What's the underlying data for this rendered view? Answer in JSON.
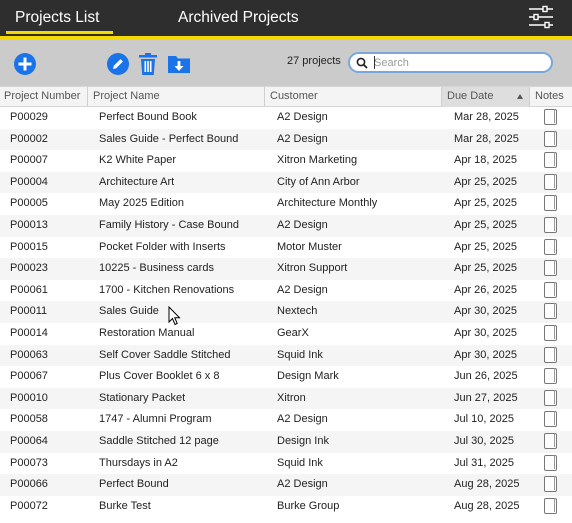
{
  "tabs": {
    "projects_list": "Projects List",
    "archived_projects": "Archived Projects"
  },
  "toolbar": {
    "project_count": "27 projects",
    "search_placeholder": "Search",
    "search_value": ""
  },
  "columns": {
    "project_number": "Project Number",
    "project_name": "Project Name",
    "customer": "Customer",
    "due_date": "Due Date",
    "notes": "Notes"
  },
  "sort": {
    "column": "due_date",
    "direction": "ascending"
  },
  "colors": {
    "accent": "#f5d800",
    "topbar": "#2e2e2e",
    "toolbar": "#cbcbcb",
    "icon_blue": "#1a73e8"
  },
  "icons": {
    "add": "plus-circle-icon",
    "edit": "pencil-icon",
    "delete": "trash-icon",
    "archive": "folder-download-icon",
    "menu": "sliders-icon",
    "search": "search-icon",
    "notes": "note-icon"
  },
  "projects": [
    {
      "number": "P00029",
      "name": "Perfect Bound Book",
      "customer": "A2 Design",
      "due": "Mar 28, 2025"
    },
    {
      "number": "P00002",
      "name": "Sales Guide - Perfect Bound",
      "customer": "A2 Design",
      "due": "Mar 28, 2025"
    },
    {
      "number": "P00007",
      "name": "K2 White Paper",
      "customer": "Xitron Marketing",
      "due": "Apr 18, 2025"
    },
    {
      "number": "P00004",
      "name": "Architecture Art",
      "customer": "City of Ann Arbor",
      "due": "Apr 25, 2025"
    },
    {
      "number": "P00005",
      "name": "May 2025 Edition",
      "customer": "Architecture Monthly",
      "due": "Apr 25, 2025"
    },
    {
      "number": "P00013",
      "name": "Family History - Case Bound",
      "customer": "A2 Design",
      "due": "Apr 25, 2025"
    },
    {
      "number": "P00015",
      "name": "Pocket Folder with Inserts",
      "customer": "Motor Muster",
      "due": "Apr 25, 2025"
    },
    {
      "number": "P00023",
      "name": "10225 - Business cards",
      "customer": "Xitron Support",
      "due": "Apr 25, 2025"
    },
    {
      "number": "P00061",
      "name": "1700 - Kitchen Renovations",
      "customer": "A2 Design",
      "due": "Apr 26, 2025"
    },
    {
      "number": "P00011",
      "name": "Sales Guide",
      "customer": "Nextech",
      "due": "Apr 30, 2025"
    },
    {
      "number": "P00014",
      "name": "Restoration Manual",
      "customer": "GearX",
      "due": "Apr 30, 2025"
    },
    {
      "number": "P00063",
      "name": "Self Cover Saddle Stitched",
      "customer": "Squid Ink",
      "due": "Apr 30, 2025"
    },
    {
      "number": "P00067",
      "name": "Plus Cover Booklet 6 x 8",
      "customer": "Design Mark",
      "due": "Jun 26, 2025"
    },
    {
      "number": "P00010",
      "name": "Stationary Packet",
      "customer": "Xitron",
      "due": "Jun 27, 2025"
    },
    {
      "number": "P00058",
      "name": "1747 - Alumni Program",
      "customer": "A2 Design",
      "due": "Jul 10, 2025"
    },
    {
      "number": "P00064",
      "name": "Saddle Stitched 12 page",
      "customer": "Design Ink",
      "due": "Jul 30, 2025"
    },
    {
      "number": "P00073",
      "name": "Thursdays in A2",
      "customer": "Squid Ink",
      "due": "Jul 31, 2025"
    },
    {
      "number": "P00066",
      "name": "Perfect Bound",
      "customer": "A2 Design",
      "due": "Aug 28, 2025"
    },
    {
      "number": "P00072",
      "name": "Burke Test",
      "customer": "Burke Group",
      "due": "Aug 28, 2025"
    }
  ]
}
